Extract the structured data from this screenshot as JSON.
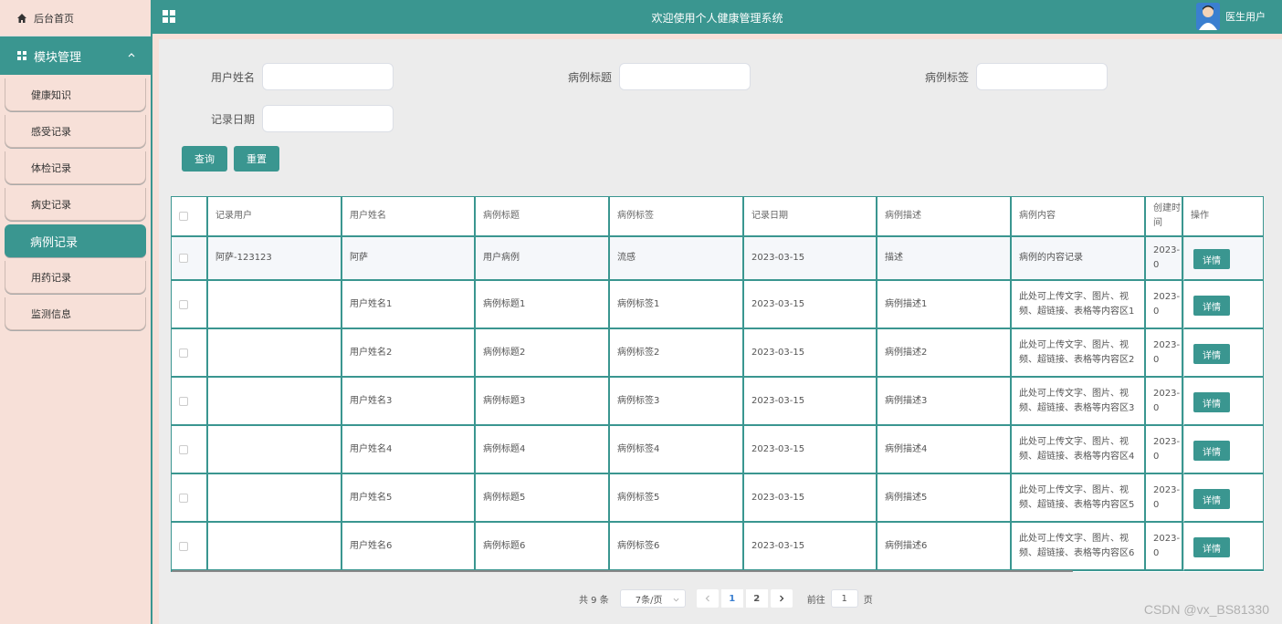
{
  "sidebar": {
    "home_label": "后台首页",
    "group_label": "模块管理",
    "items": [
      {
        "label": "健康知识",
        "active": false
      },
      {
        "label": "感受记录",
        "active": false
      },
      {
        "label": "体检记录",
        "active": false
      },
      {
        "label": "病史记录",
        "active": false
      },
      {
        "label": "病例记录",
        "active": true
      },
      {
        "label": "用药记录",
        "active": false
      },
      {
        "label": "监测信息",
        "active": false
      }
    ]
  },
  "header": {
    "title": "欢迎使用个人健康管理系统",
    "user_label": "医生用户"
  },
  "search": {
    "user_name_label": "用户姓名",
    "case_title_label": "病例标题",
    "case_tag_label": "病例标签",
    "record_date_label": "记录日期",
    "query_button": "查询",
    "reset_button": "重置"
  },
  "table": {
    "headers": [
      "记录用户",
      "用户姓名",
      "病例标题",
      "病例标签",
      "记录日期",
      "病例描述",
      "病例内容",
      "创建时间",
      "操作"
    ],
    "rows": [
      {
        "user": "阿萨-123123",
        "name": "阿萨",
        "title": "用户病例",
        "tag": "流感",
        "date": "2023-03-15",
        "desc": "描述",
        "content": "病例的内容记录",
        "created": "2023-0",
        "action": "详情"
      },
      {
        "user": "",
        "name": "用户姓名1",
        "title": "病例标题1",
        "tag": "病例标签1",
        "date": "2023-03-15",
        "desc": "病例描述1",
        "content": "此处可上传文字、图片、视频、超链接、表格等内容区1",
        "created": "2023-0",
        "action": "详情"
      },
      {
        "user": "",
        "name": "用户姓名2",
        "title": "病例标题2",
        "tag": "病例标签2",
        "date": "2023-03-15",
        "desc": "病例描述2",
        "content": "此处可上传文字、图片、视频、超链接、表格等内容区2",
        "created": "2023-0",
        "action": "详情"
      },
      {
        "user": "",
        "name": "用户姓名3",
        "title": "病例标题3",
        "tag": "病例标签3",
        "date": "2023-03-15",
        "desc": "病例描述3",
        "content": "此处可上传文字、图片、视频、超链接、表格等内容区3",
        "created": "2023-0",
        "action": "详情"
      },
      {
        "user": "",
        "name": "用户姓名4",
        "title": "病例标题4",
        "tag": "病例标签4",
        "date": "2023-03-15",
        "desc": "病例描述4",
        "content": "此处可上传文字、图片、视频、超链接、表格等内容区4",
        "created": "2023-0",
        "action": "详情"
      },
      {
        "user": "",
        "name": "用户姓名5",
        "title": "病例标题5",
        "tag": "病例标签5",
        "date": "2023-03-15",
        "desc": "病例描述5",
        "content": "此处可上传文字、图片、视频、超链接、表格等内容区5",
        "created": "2023-0",
        "action": "详情"
      },
      {
        "user": "",
        "name": "用户姓名6",
        "title": "病例标题6",
        "tag": "病例标签6",
        "date": "2023-03-15",
        "desc": "病例描述6",
        "content": "此处可上传文字、图片、视频、超链接、表格等内容区6",
        "created": "2023-0",
        "action": "详情"
      }
    ]
  },
  "pagination": {
    "total_text": "共 9 条",
    "page_size": "7条/页",
    "pages": [
      "1",
      "2"
    ],
    "current_page": "1",
    "goto_label": "前往",
    "goto_value": "1",
    "page_suffix": "页"
  },
  "watermark": "CSDN @vx_BS81330",
  "colors": {
    "accent": "#3a9690",
    "sidebar_bg": "#f7e0d8",
    "panel_bg": "#ececec"
  },
  "icons": {
    "home": "home-icon",
    "module": "grid-icon",
    "menu": "menu-grid-icon"
  }
}
